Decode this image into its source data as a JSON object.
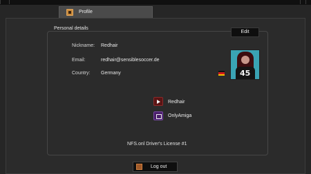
{
  "tab": {
    "label": "Profile",
    "icon": "profile-card-icon"
  },
  "section": {
    "title": "Personal details",
    "edit_label": "Edit"
  },
  "fields": {
    "nickname_label": "Nickname:",
    "nickname_value": "Redhair",
    "email_label": "Email:",
    "email_value": "redhair@sensiblesoccer.de",
    "country_label": "Country:",
    "country_value": "Germany"
  },
  "avatar": {
    "jersey_number": "45"
  },
  "social": {
    "youtube": "Redhair",
    "twitch": "OnlyAmiga"
  },
  "license": "NFS.onl Driver's License #1",
  "logout_label": "Log out",
  "colors": {
    "accent_orange": "#c98a3c",
    "youtube": "#5a1414",
    "twitch": "#4a1f6a"
  }
}
